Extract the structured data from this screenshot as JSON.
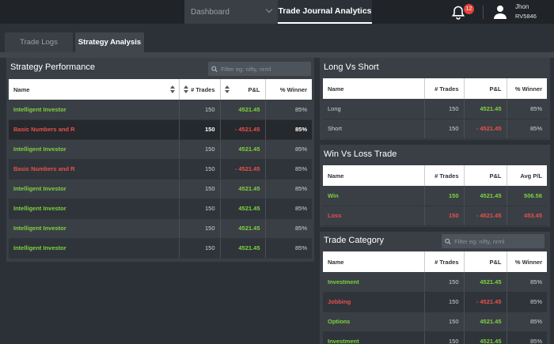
{
  "nav": {
    "dashboard": "Dashboard",
    "active": "Trade Journal Analytics",
    "notifications_count": "12",
    "user_name": "Jhon",
    "user_id": "RV5846"
  },
  "tabs": {
    "trade_logs": "Trade Logs",
    "strategy_analysis": "Strategy Analysis"
  },
  "strategy_performance": {
    "title": "Strategy Performance",
    "search_placeholder": "Filter eg: nifty, nrml",
    "headers": [
      "Name",
      "# Trades",
      "P&L",
      "% Winner"
    ],
    "rows": [
      {
        "name": "Intelligent Investor",
        "trades": "150",
        "pnl": "4521.45",
        "winner": "85%",
        "status": "profit"
      },
      {
        "name": "Basic Numbers and R",
        "trades": "150",
        "pnl": "- 4521.45",
        "winner": "85%",
        "status": "loss"
      },
      {
        "name": "Intelligent Investor",
        "trades": "150",
        "pnl": "4521.45",
        "winner": "85%",
        "status": "profit"
      },
      {
        "name": "Basic Numbers and R",
        "trades": "150",
        "pnl": "- 4521.45",
        "winner": "85%",
        "status": "loss"
      },
      {
        "name": "Intelligent Investor",
        "trades": "150",
        "pnl": "4521.45",
        "winner": "85%",
        "status": "profit"
      },
      {
        "name": "Intelligent Investor",
        "trades": "150",
        "pnl": "4521.45",
        "winner": "85%",
        "status": "profit"
      },
      {
        "name": "Intelligent Investor",
        "trades": "150",
        "pnl": "4521.45",
        "winner": "85%",
        "status": "profit"
      },
      {
        "name": "Intelligent Investor",
        "trades": "150",
        "pnl": "4521.45",
        "winner": "85%",
        "status": "profit"
      }
    ]
  },
  "long_vs_short": {
    "title": "Long Vs Short",
    "headers": [
      "Name",
      "# Trades",
      "P&L",
      "% Winner"
    ],
    "rows": [
      {
        "name": "Long",
        "trades": "150",
        "pnl": "4521.45",
        "winner": "85%"
      },
      {
        "name": "Short",
        "trades": "150",
        "pnl": "- 4521.45",
        "winner": "85%"
      }
    ]
  },
  "win_vs_loss": {
    "title": "Win Vs Loss Trade",
    "headers": [
      "Name",
      "# Trades",
      "P&L",
      "Avg P/L"
    ],
    "rows": [
      {
        "name": "Win",
        "trades": "150",
        "pnl": "4521.45",
        "avg": "506.56"
      },
      {
        "name": "Loss",
        "trades": "150",
        "pnl": "- 4521.45",
        "avg": "453.45"
      }
    ]
  },
  "trade_category": {
    "title": "Trade Category",
    "search_placeholder": "Filter eg: nifty, nrml",
    "headers": [
      "Name",
      "# Trades",
      "P&L",
      "% Winner"
    ],
    "rows": [
      {
        "name": "Investment",
        "trades": "150",
        "pnl": "4521.45",
        "winner": "85%"
      },
      {
        "name": "Jobbing",
        "trades": "150",
        "pnl": "- 4521.45",
        "winner": "85%"
      },
      {
        "name": "Options",
        "trades": "150",
        "pnl": "4521.45",
        "winner": "85%"
      },
      {
        "name": "Investment",
        "trades": "150",
        "pnl": "4521.45",
        "winner": "85%"
      }
    ]
  },
  "colors": {
    "profit": "#7dd23f",
    "loss": "#e8514a",
    "badge": "#e2443c"
  }
}
